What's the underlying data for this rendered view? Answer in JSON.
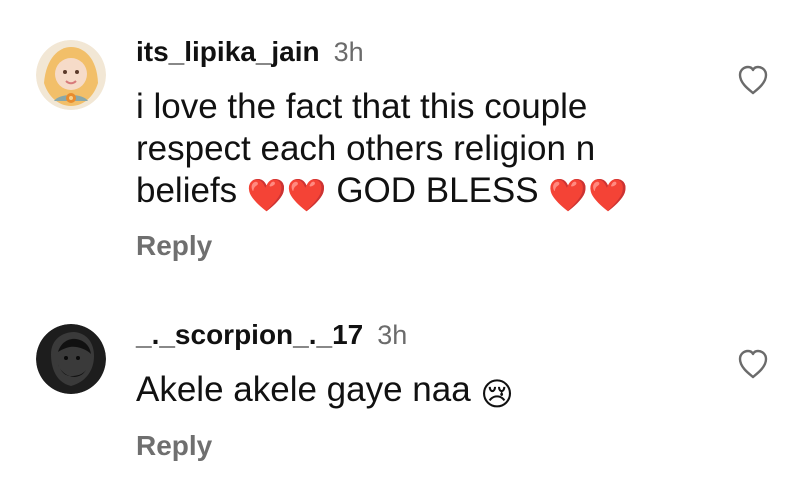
{
  "comments": [
    {
      "username": "its_lipika_jain",
      "time": "3h",
      "text_parts": {
        "line1": "i love the fact that this couple",
        "line2": "respect each others religion n",
        "line3_a": "beliefs",
        "emoji_a": "❤️❤️",
        "line3_b": "GOD BLESS",
        "emoji_b": "❤️❤️"
      },
      "reply_label": "Reply"
    },
    {
      "username": "_._scorpion_._17",
      "time": "3h",
      "text_parts": {
        "line1": "Akele akele gaye naa",
        "emoji_a": "😢"
      },
      "reply_label": "Reply"
    }
  ],
  "icons": {
    "like": "heart-outline-icon"
  },
  "colors": {
    "username": "#111111",
    "time": "#6b6b6b",
    "reply": "#6f6f6f",
    "icon": "#6b6b6b"
  }
}
